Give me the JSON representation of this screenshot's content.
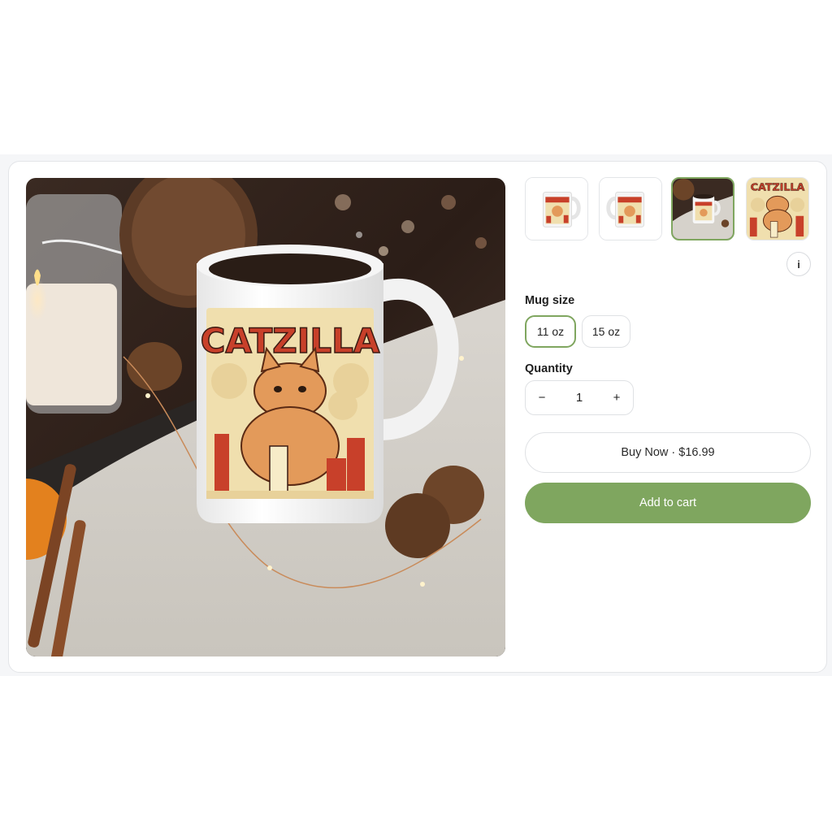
{
  "product": {
    "mug_print_text": "CATZILLA"
  },
  "gallery": {
    "thumbnails": [
      {
        "name": "mug-front-view"
      },
      {
        "name": "mug-handle-view"
      },
      {
        "name": "mug-lifestyle-view",
        "selected": true
      },
      {
        "name": "design-artwork-view"
      }
    ],
    "info_label": "i"
  },
  "options": {
    "size_label": "Mug size",
    "sizes": [
      {
        "label": "11 oz",
        "selected": true
      },
      {
        "label": "15 oz",
        "selected": false
      }
    ]
  },
  "quantity": {
    "label": "Quantity",
    "decrement": "−",
    "value": "1",
    "increment": "+"
  },
  "actions": {
    "buy_now": "Buy Now · $16.99",
    "add_to_cart": "Add to cart"
  },
  "colors": {
    "accent": "#7fa65f",
    "print_red": "#c8402a",
    "print_cream": "#f0dfae"
  },
  "icons": {
    "info": "info-icon",
    "minus": "minus-icon",
    "plus": "plus-icon"
  }
}
